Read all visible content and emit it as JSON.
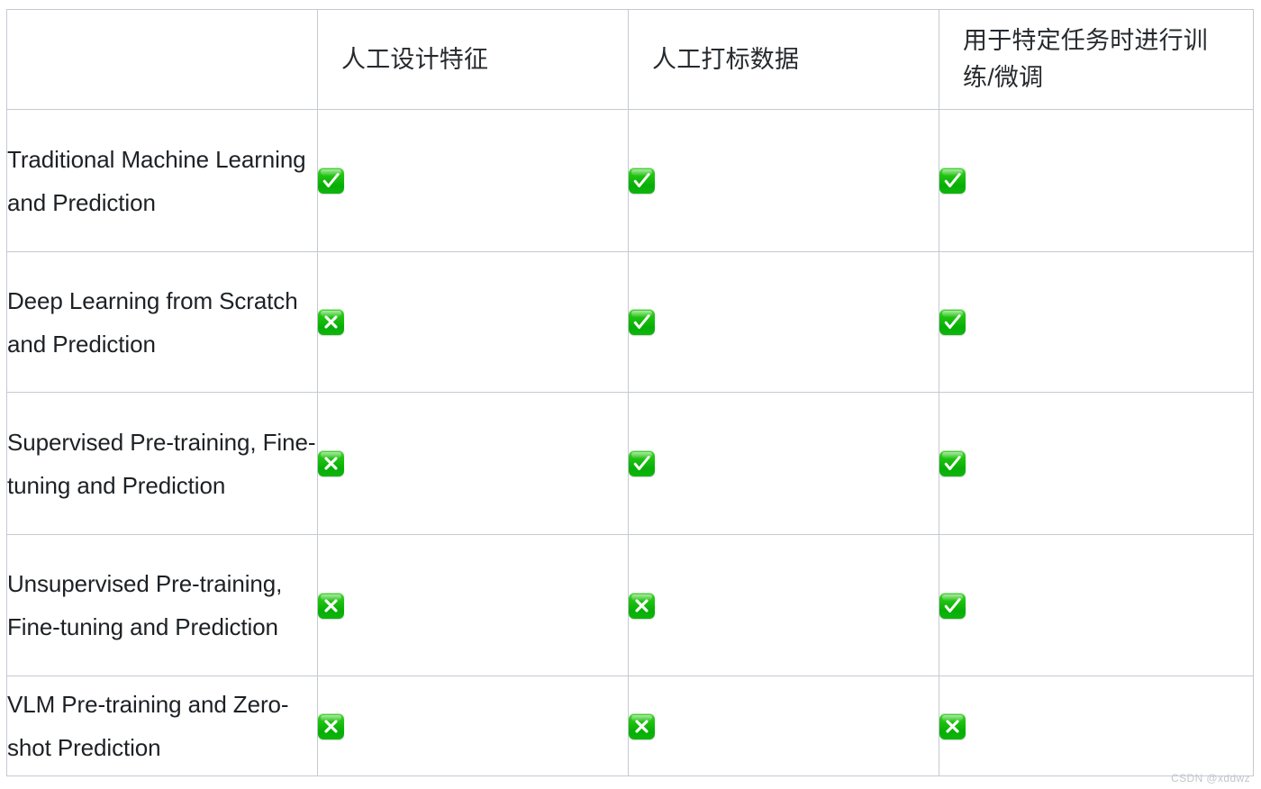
{
  "table": {
    "corner_label": "",
    "columns": [
      {
        "key": "handcrafted_features",
        "label": "人工设计特征"
      },
      {
        "key": "human_labeled_data",
        "label": "人工打标数据"
      },
      {
        "key": "task_specific_training",
        "label": "用于特定任务时进行训练/微调"
      }
    ],
    "rows": [
      {
        "label": "Traditional Machine Learning and Prediction",
        "cells": [
          {
            "state": "yes",
            "icon": "check-mark-button-icon",
            "symbol": "✅"
          },
          {
            "state": "yes",
            "icon": "check-mark-button-icon",
            "symbol": "✅"
          },
          {
            "state": "yes",
            "icon": "check-mark-button-icon",
            "symbol": "✅"
          }
        ]
      },
      {
        "label": "Deep Learning from Scratch and Prediction",
        "cells": [
          {
            "state": "no",
            "icon": "cross-mark-button-icon",
            "symbol": "❎"
          },
          {
            "state": "yes",
            "icon": "check-mark-button-icon",
            "symbol": "✅"
          },
          {
            "state": "yes",
            "icon": "check-mark-button-icon",
            "symbol": "✅"
          }
        ]
      },
      {
        "label": "Supervised Pre-training, Fine-tuning and Prediction",
        "cells": [
          {
            "state": "no",
            "icon": "cross-mark-button-icon",
            "symbol": "❎"
          },
          {
            "state": "yes",
            "icon": "check-mark-button-icon",
            "symbol": "✅"
          },
          {
            "state": "yes",
            "icon": "check-mark-button-icon",
            "symbol": "✅"
          }
        ]
      },
      {
        "label": "Unsupervised Pre-training, Fine-tuning and Prediction",
        "cells": [
          {
            "state": "no",
            "icon": "cross-mark-button-icon",
            "symbol": "❎"
          },
          {
            "state": "no",
            "icon": "cross-mark-button-icon",
            "symbol": "❎"
          },
          {
            "state": "yes",
            "icon": "check-mark-button-icon",
            "symbol": "✅"
          }
        ]
      },
      {
        "label": "VLM Pre-training and Zero-shot Prediction",
        "cells": [
          {
            "state": "no",
            "icon": "cross-mark-button-icon",
            "symbol": "❎"
          },
          {
            "state": "no",
            "icon": "cross-mark-button-icon",
            "symbol": "❎"
          },
          {
            "state": "no",
            "icon": "cross-mark-button-icon",
            "symbol": "❎"
          }
        ]
      }
    ]
  },
  "colors": {
    "border": "#c5c9d1",
    "text": "#1d2125",
    "icon_green": "#0ab80a",
    "icon_green_light": "#4ed23c",
    "watermark": "#c2c6cc"
  },
  "watermark": {
    "text": "CSDN @xddwz"
  }
}
